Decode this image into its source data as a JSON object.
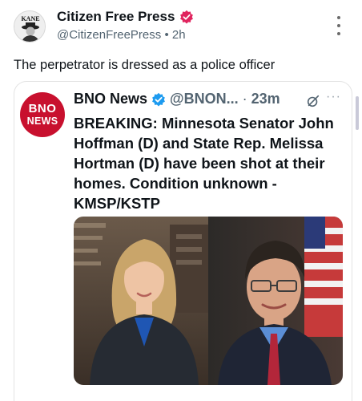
{
  "post": {
    "author_name": "Citizen Free Press",
    "handle": "@CitizenFreePress",
    "separator": "•",
    "time": "2h",
    "text": "The perpetrator is dressed as a police officer",
    "avatar_text": "KANE"
  },
  "quote": {
    "logo_line1": "BNO",
    "logo_line2": "NEWS",
    "name": "BNO News",
    "handle": "@BNON...",
    "separator": "·",
    "time": "23m",
    "more": "···",
    "body": "BREAKING: Minnesota Senator John Hoffman (D) and State Rep. Melissa Hortman (D) have been shot at their homes. Condition unknown - KMSP/KSTP"
  },
  "icons": {
    "verified": "verified-badge-icon",
    "quote_verified": "verified-check-icon",
    "grok": "grok-icon",
    "more": "more-vertical-icon"
  },
  "colors": {
    "verified_pink": "#e0245e",
    "verified_blue": "#1d9bf0",
    "bno_red": "#c8102e"
  }
}
